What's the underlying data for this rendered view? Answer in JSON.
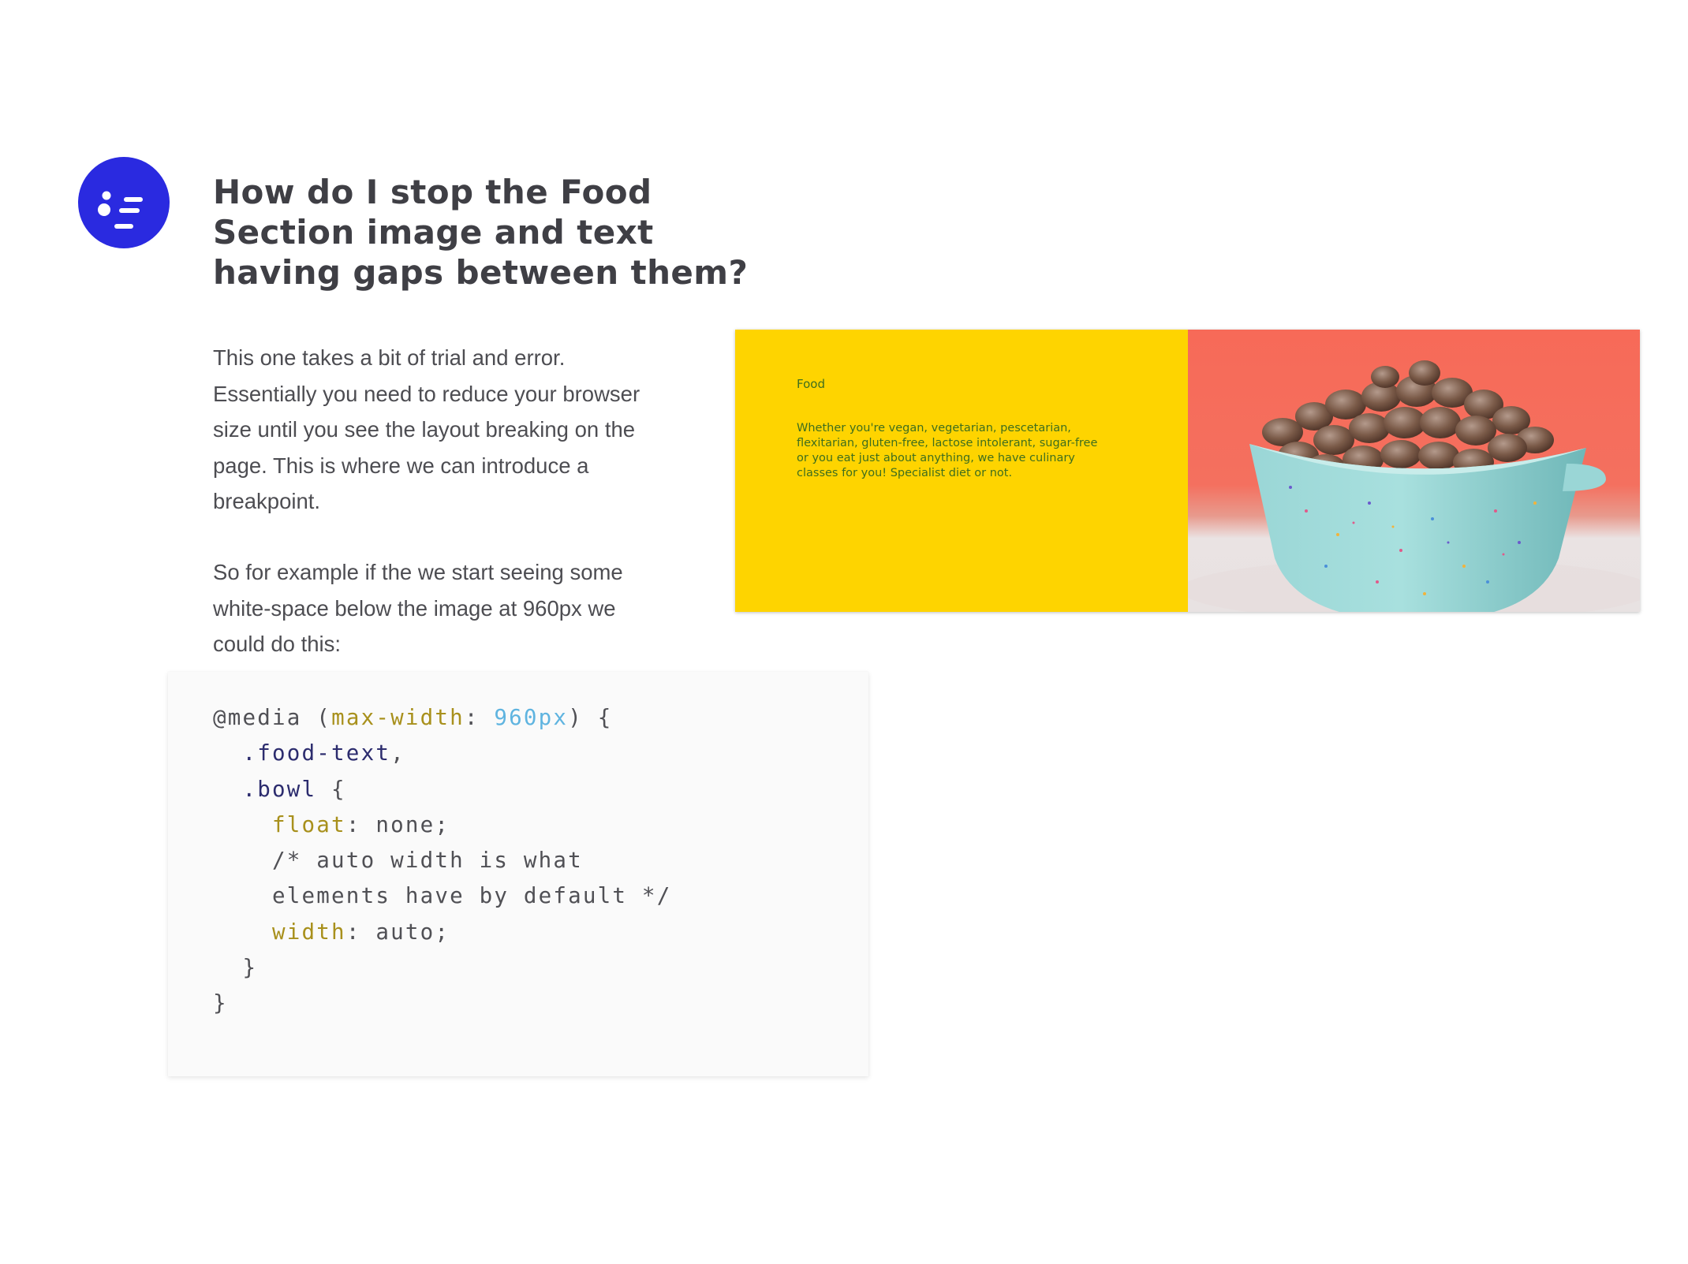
{
  "avatar": {
    "icon": "smirk-face-icon",
    "color": "#2a2ae0"
  },
  "heading": {
    "title": "How do I stop the Food Section image and text having gaps between them?"
  },
  "body": {
    "paragraph_1": "This one takes a bit of trial and error. Essentially you need to reduce your browser size until you see the layout breaking on the page. This is where we can introduce a breakpoint.",
    "paragraph_2": "So for example if the we start seeing some white-space below the image at 960px we could do this:"
  },
  "code": {
    "line_1": {
      "at_rule": "@media",
      "open_paren": " (",
      "property": "max-width",
      "colon": ": ",
      "value": "960px",
      "close": ") {"
    },
    "line_2": {
      "selector": "  .food-text",
      "punct": ","
    },
    "line_3": {
      "selector": "  .bowl",
      "punct": " {"
    },
    "line_4": {
      "indent": "    ",
      "property": "float",
      "rest": ": none;"
    },
    "line_5": "    /* auto width is what",
    "line_6": "    elements have by default */",
    "line_7": {
      "indent": "    ",
      "property": "width",
      "rest": ": auto;"
    },
    "line_8": "  }",
    "line_9": "}",
    "colors": {
      "property": "#a8901c",
      "number": "#5fb4e0",
      "selector": "#2c2c6e",
      "plain": "#505055"
    }
  },
  "preview": {
    "food_label": "Food",
    "food_description": "Whether you're vegan, vegetarian, pescetarian, flexitarian, gluten-free, lactose intolerant, sugar-free or you eat just about anything, we have culinary classes for you! Specialist diet or not.",
    "text_panel_color": "#fed400",
    "photo_background_color": "#f76a58",
    "bowl_color": "#8fd3d3",
    "photo_subject": "bowl-of-nuts-image"
  }
}
